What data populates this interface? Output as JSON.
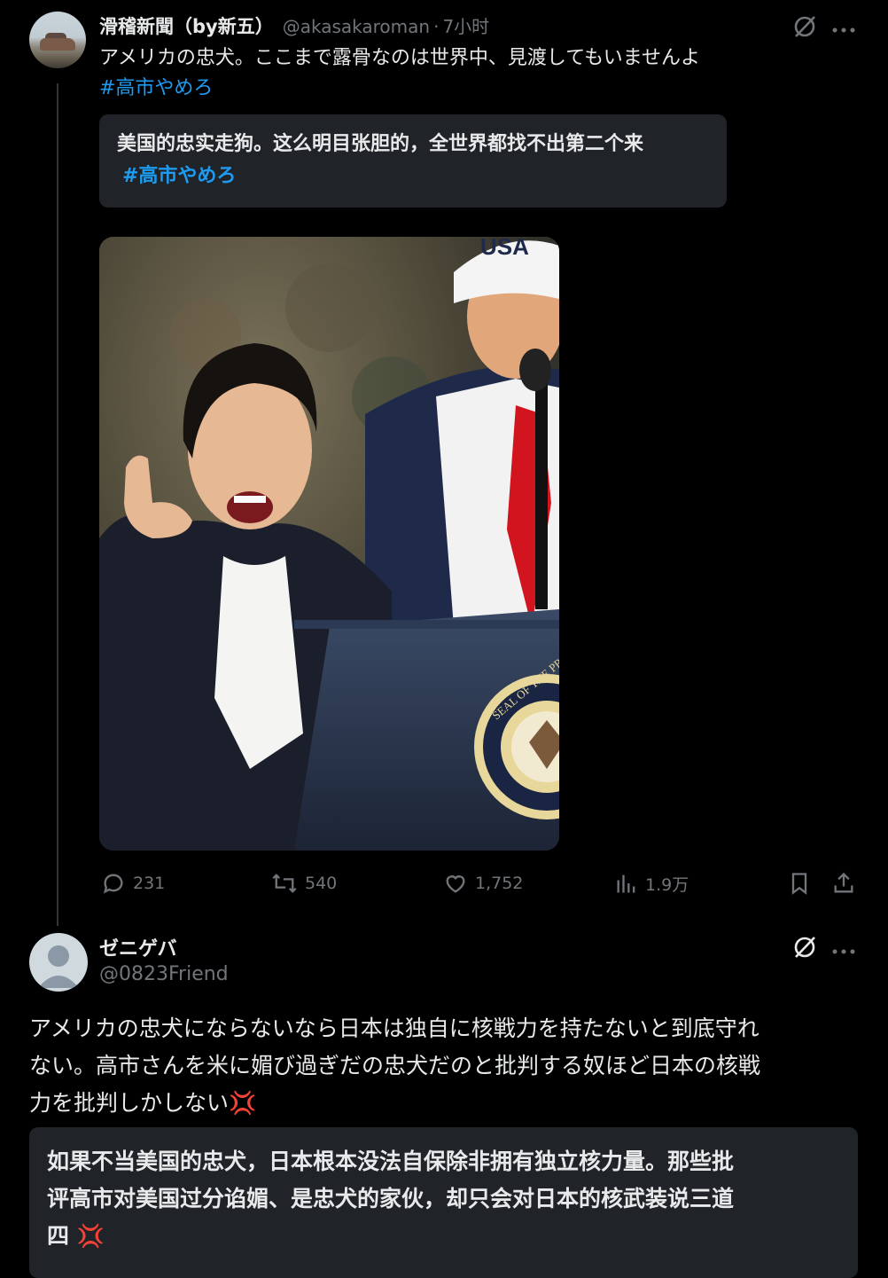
{
  "post": {
    "display_name": "滑稽新聞（by新五）",
    "handle": "@akasakaroman",
    "separator": "·",
    "time": "7小时",
    "text": "アメリカの忠犬。ここまで露骨なのは世界中、見渡してもいませんよ",
    "hashtag": "#高市やめろ",
    "translation": {
      "text": "美国的忠实走狗。这么明目张胆的，全世界都找不出第二个来",
      "hashtag": "#高市やめろ"
    },
    "image": {
      "emblem_text": "SEAL OF THE PRESIDENT"
    },
    "actions": {
      "replies": "231",
      "reposts": "540",
      "likes": "1,752",
      "views": "1.9万"
    }
  },
  "reply": {
    "display_name": "ゼニゲバ",
    "handle": "@0823Friend",
    "text_lines": [
      "アメリカの忠犬にならないなら日本は独自に核戦力を持たないと到底守れ",
      "ない。高市さんを米に媚び過ぎだの忠犬だのと批判する奴ほど日本の核戦",
      "力を批判しかしない"
    ],
    "emoji": "💢",
    "translation_lines": [
      "如果不当美国的忠犬，日本根本没法自保除非拥有独立核力量。那些批",
      "评高市对美国过分谄媚、是忠犬的家伙，却只会对日本的核武装说三道",
      "四"
    ]
  },
  "icons": {
    "grok": "grok-icon",
    "more": "more-icon",
    "reply": "reply-icon",
    "repost": "repost-icon",
    "like": "like-icon",
    "views": "views-icon",
    "bookmark": "bookmark-icon",
    "share": "share-icon"
  },
  "colors": {
    "background": "#000000",
    "text": "#e7e9ea",
    "secondary": "#71767b",
    "accent": "#1d9bf0",
    "quote_bg": "#202327",
    "anger": "#f4212e"
  }
}
